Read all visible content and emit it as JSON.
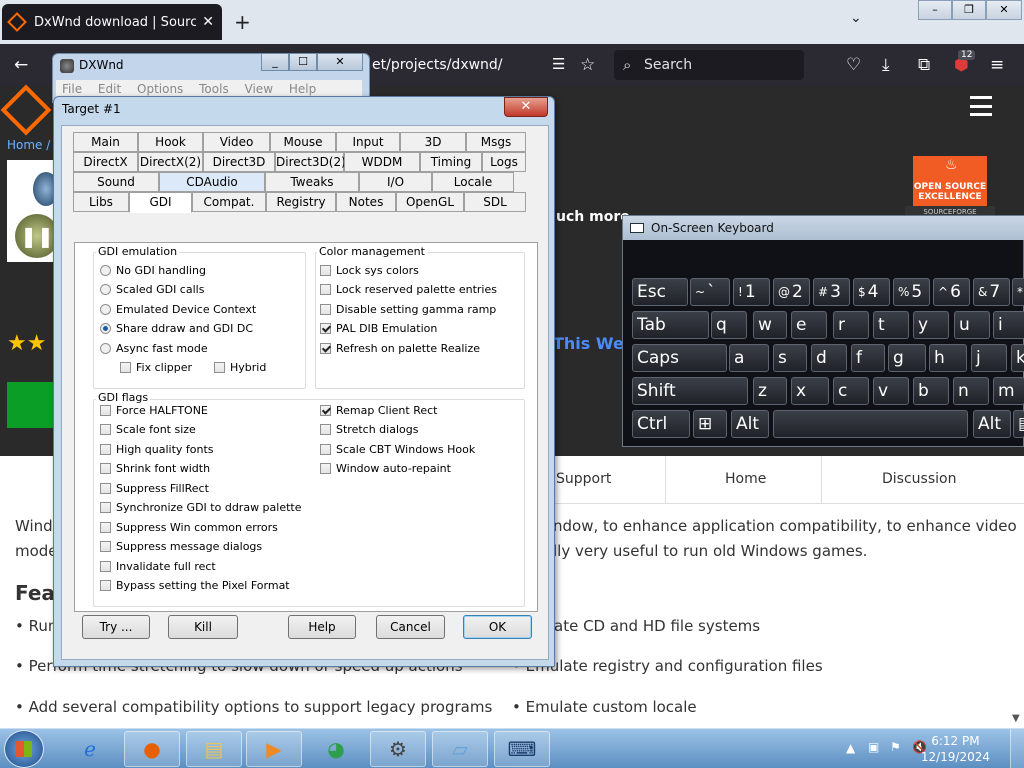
{
  "browser": {
    "tab_title": "DxWnd download | SourceForge",
    "tab_close": "✕",
    "new_tab": "+",
    "tab_list": "⌄",
    "url": "/projects/dxwnd/",
    "url_prefix": "et",
    "search_placeholder": "Search",
    "ext_badge": "12",
    "win_min": "–",
    "win_max": "❐",
    "win_close": "✕"
  },
  "page": {
    "breadcrumb": "Home /",
    "much_more": "uch more",
    "this_week": "This We",
    "ose_badge": "OPEN SOURCE EXCELLENCE",
    "sf_strip": "SOURCEFORGE",
    "subnav": [
      "Support",
      "Home",
      "Discussion"
    ],
    "body_left_1": "Wind",
    "body_left_2": "mode",
    "body_right_1": "ndow, to enhance application compatibility, to enhance video",
    "body_right_2": "lly very useful to run old Windows games.",
    "features_heading": "Feat",
    "feat_left_1": "• Run",
    "feat_right_1": "ate CD and HD file systems",
    "feat_left_2": "• Perform time stretching to slow down or speed up actions",
    "feat_right_2": "• Emulate registry and configuration files",
    "feat_left_3": "• Add several compatibility options to support legacy programs",
    "feat_right_3": "• Emulate custom locale"
  },
  "dxwnd": {
    "title": "DXWnd",
    "menu": [
      "File",
      "Edit",
      "Options",
      "Tools",
      "View",
      "Help"
    ]
  },
  "dialog": {
    "title": "Target #1",
    "close": "✕",
    "tab_rows": [
      [
        "Main",
        "Hook",
        "Video",
        "Mouse",
        "Input",
        "3D",
        "Msgs"
      ],
      [
        "DirectX",
        "DirectX(2)",
        "Direct3D",
        "Direct3D(2)",
        "WDDM",
        "Timing",
        "Logs"
      ],
      [
        "Sound",
        "CDAudio",
        "Tweaks",
        "I/O",
        "Locale"
      ],
      [
        "Libs",
        "GDI",
        "Compat.",
        "Registry",
        "Notes",
        "OpenGL",
        "SDL"
      ]
    ],
    "selected_tab": "GDI",
    "gdi_emulation": {
      "title": "GDI emulation",
      "options": [
        {
          "label": "No GDI handling",
          "checked": false
        },
        {
          "label": "Scaled GDI calls",
          "checked": false
        },
        {
          "label": "Emulated Device Context",
          "checked": false
        },
        {
          "label": "Share ddraw and GDI DC",
          "checked": true
        },
        {
          "label": "Async fast mode",
          "checked": false
        }
      ],
      "fix_clipper": {
        "label": "Fix clipper",
        "checked": false
      },
      "hybrid": {
        "label": "Hybrid",
        "checked": false
      }
    },
    "color_management": {
      "title": "Color management",
      "options": [
        {
          "label": "Lock sys colors",
          "checked": false
        },
        {
          "label": "Lock reserved palette entries",
          "checked": false
        },
        {
          "label": "Disable setting gamma ramp",
          "checked": false
        },
        {
          "label": "PAL DIB Emulation",
          "checked": true
        },
        {
          "label": "Refresh on palette Realize",
          "checked": true
        }
      ]
    },
    "gdi_flags": {
      "title": "GDI flags",
      "left": [
        {
          "label": "Force HALFTONE",
          "checked": false
        },
        {
          "label": "Scale font size",
          "checked": false
        },
        {
          "label": "High quality fonts",
          "checked": false
        },
        {
          "label": "Shrink font width",
          "checked": false
        },
        {
          "label": "Suppress FillRect",
          "checked": false
        },
        {
          "label": "Synchronize GDI to ddraw palette",
          "checked": false
        },
        {
          "label": "Suppress Win common errors",
          "checked": false
        },
        {
          "label": "Suppress message dialogs",
          "checked": false
        },
        {
          "label": "Invalidate full rect",
          "checked": false
        },
        {
          "label": "Bypass setting the Pixel Format",
          "checked": false
        }
      ],
      "right": [
        {
          "label": "Remap Client Rect",
          "checked": true
        },
        {
          "label": "Stretch dialogs",
          "checked": false
        },
        {
          "label": "Scale CBT Windows Hook",
          "checked": false
        },
        {
          "label": "Window auto-repaint",
          "checked": false
        }
      ]
    },
    "buttons": {
      "try": "Try ...",
      "kill": "Kill",
      "help": "Help",
      "cancel": "Cancel",
      "ok": "OK"
    }
  },
  "osk": {
    "title": "On-Screen Keyboard",
    "row1": [
      {
        "k": "Esc"
      },
      {
        "s": "~",
        "k": "`"
      },
      {
        "s": "!",
        "k": "1"
      },
      {
        "s": "@",
        "k": "2"
      },
      {
        "s": "#",
        "k": "3"
      },
      {
        "s": "$",
        "k": "4"
      },
      {
        "s": "%",
        "k": "5"
      },
      {
        "s": "^",
        "k": "6"
      },
      {
        "s": "&",
        "k": "7"
      },
      {
        "s": "*",
        "k": ""
      }
    ],
    "row2": [
      "Tab",
      "q",
      "w",
      "e",
      "r",
      "t",
      "y",
      "u",
      "i"
    ],
    "row3": [
      "Caps",
      "a",
      "s",
      "d",
      "f",
      "g",
      "h",
      "j",
      "k"
    ],
    "row4": [
      "Shift",
      "z",
      "x",
      "c",
      "v",
      "b",
      "n",
      "m"
    ],
    "row5": [
      "Ctrl",
      "⊞",
      "Alt",
      "",
      "Alt",
      "▤"
    ]
  },
  "taskbar": {
    "time": "6:12 PM",
    "date": "12/19/2024",
    "apps": [
      "internet-explorer",
      "firefox",
      "file-explorer",
      "media-player",
      "game-app",
      "dxwnd",
      "notepad",
      "on-screen-keyboard"
    ]
  }
}
